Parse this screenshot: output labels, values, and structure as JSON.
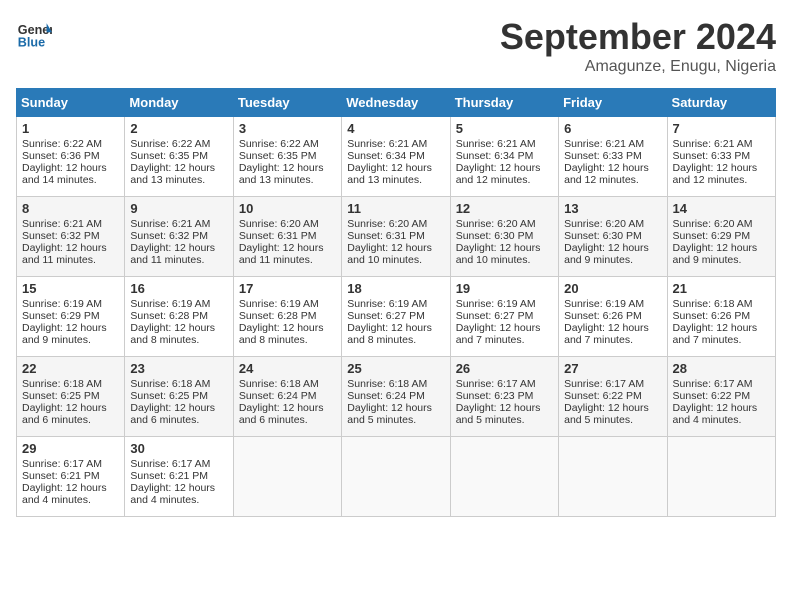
{
  "header": {
    "logo_line1": "General",
    "logo_line2": "Blue",
    "month": "September 2024",
    "location": "Amagunze, Enugu, Nigeria"
  },
  "weekdays": [
    "Sunday",
    "Monday",
    "Tuesday",
    "Wednesday",
    "Thursday",
    "Friday",
    "Saturday"
  ],
  "weeks": [
    [
      {
        "day": "1",
        "lines": [
          "Sunrise: 6:22 AM",
          "Sunset: 6:36 PM",
          "Daylight: 12 hours",
          "and 14 minutes."
        ]
      },
      {
        "day": "2",
        "lines": [
          "Sunrise: 6:22 AM",
          "Sunset: 6:35 PM",
          "Daylight: 12 hours",
          "and 13 minutes."
        ]
      },
      {
        "day": "3",
        "lines": [
          "Sunrise: 6:22 AM",
          "Sunset: 6:35 PM",
          "Daylight: 12 hours",
          "and 13 minutes."
        ]
      },
      {
        "day": "4",
        "lines": [
          "Sunrise: 6:21 AM",
          "Sunset: 6:34 PM",
          "Daylight: 12 hours",
          "and 13 minutes."
        ]
      },
      {
        "day": "5",
        "lines": [
          "Sunrise: 6:21 AM",
          "Sunset: 6:34 PM",
          "Daylight: 12 hours",
          "and 12 minutes."
        ]
      },
      {
        "day": "6",
        "lines": [
          "Sunrise: 6:21 AM",
          "Sunset: 6:33 PM",
          "Daylight: 12 hours",
          "and 12 minutes."
        ]
      },
      {
        "day": "7",
        "lines": [
          "Sunrise: 6:21 AM",
          "Sunset: 6:33 PM",
          "Daylight: 12 hours",
          "and 12 minutes."
        ]
      }
    ],
    [
      {
        "day": "8",
        "lines": [
          "Sunrise: 6:21 AM",
          "Sunset: 6:32 PM",
          "Daylight: 12 hours",
          "and 11 minutes."
        ]
      },
      {
        "day": "9",
        "lines": [
          "Sunrise: 6:21 AM",
          "Sunset: 6:32 PM",
          "Daylight: 12 hours",
          "and 11 minutes."
        ]
      },
      {
        "day": "10",
        "lines": [
          "Sunrise: 6:20 AM",
          "Sunset: 6:31 PM",
          "Daylight: 12 hours",
          "and 11 minutes."
        ]
      },
      {
        "day": "11",
        "lines": [
          "Sunrise: 6:20 AM",
          "Sunset: 6:31 PM",
          "Daylight: 12 hours",
          "and 10 minutes."
        ]
      },
      {
        "day": "12",
        "lines": [
          "Sunrise: 6:20 AM",
          "Sunset: 6:30 PM",
          "Daylight: 12 hours",
          "and 10 minutes."
        ]
      },
      {
        "day": "13",
        "lines": [
          "Sunrise: 6:20 AM",
          "Sunset: 6:30 PM",
          "Daylight: 12 hours",
          "and 9 minutes."
        ]
      },
      {
        "day": "14",
        "lines": [
          "Sunrise: 6:20 AM",
          "Sunset: 6:29 PM",
          "Daylight: 12 hours",
          "and 9 minutes."
        ]
      }
    ],
    [
      {
        "day": "15",
        "lines": [
          "Sunrise: 6:19 AM",
          "Sunset: 6:29 PM",
          "Daylight: 12 hours",
          "and 9 minutes."
        ]
      },
      {
        "day": "16",
        "lines": [
          "Sunrise: 6:19 AM",
          "Sunset: 6:28 PM",
          "Daylight: 12 hours",
          "and 8 minutes."
        ]
      },
      {
        "day": "17",
        "lines": [
          "Sunrise: 6:19 AM",
          "Sunset: 6:28 PM",
          "Daylight: 12 hours",
          "and 8 minutes."
        ]
      },
      {
        "day": "18",
        "lines": [
          "Sunrise: 6:19 AM",
          "Sunset: 6:27 PM",
          "Daylight: 12 hours",
          "and 8 minutes."
        ]
      },
      {
        "day": "19",
        "lines": [
          "Sunrise: 6:19 AM",
          "Sunset: 6:27 PM",
          "Daylight: 12 hours",
          "and 7 minutes."
        ]
      },
      {
        "day": "20",
        "lines": [
          "Sunrise: 6:19 AM",
          "Sunset: 6:26 PM",
          "Daylight: 12 hours",
          "and 7 minutes."
        ]
      },
      {
        "day": "21",
        "lines": [
          "Sunrise: 6:18 AM",
          "Sunset: 6:26 PM",
          "Daylight: 12 hours",
          "and 7 minutes."
        ]
      }
    ],
    [
      {
        "day": "22",
        "lines": [
          "Sunrise: 6:18 AM",
          "Sunset: 6:25 PM",
          "Daylight: 12 hours",
          "and 6 minutes."
        ]
      },
      {
        "day": "23",
        "lines": [
          "Sunrise: 6:18 AM",
          "Sunset: 6:25 PM",
          "Daylight: 12 hours",
          "and 6 minutes."
        ]
      },
      {
        "day": "24",
        "lines": [
          "Sunrise: 6:18 AM",
          "Sunset: 6:24 PM",
          "Daylight: 12 hours",
          "and 6 minutes."
        ]
      },
      {
        "day": "25",
        "lines": [
          "Sunrise: 6:18 AM",
          "Sunset: 6:24 PM",
          "Daylight: 12 hours",
          "and 5 minutes."
        ]
      },
      {
        "day": "26",
        "lines": [
          "Sunrise: 6:17 AM",
          "Sunset: 6:23 PM",
          "Daylight: 12 hours",
          "and 5 minutes."
        ]
      },
      {
        "day": "27",
        "lines": [
          "Sunrise: 6:17 AM",
          "Sunset: 6:22 PM",
          "Daylight: 12 hours",
          "and 5 minutes."
        ]
      },
      {
        "day": "28",
        "lines": [
          "Sunrise: 6:17 AM",
          "Sunset: 6:22 PM",
          "Daylight: 12 hours",
          "and 4 minutes."
        ]
      }
    ],
    [
      {
        "day": "29",
        "lines": [
          "Sunrise: 6:17 AM",
          "Sunset: 6:21 PM",
          "Daylight: 12 hours",
          "and 4 minutes."
        ]
      },
      {
        "day": "30",
        "lines": [
          "Sunrise: 6:17 AM",
          "Sunset: 6:21 PM",
          "Daylight: 12 hours",
          "and 4 minutes."
        ]
      },
      null,
      null,
      null,
      null,
      null
    ]
  ]
}
